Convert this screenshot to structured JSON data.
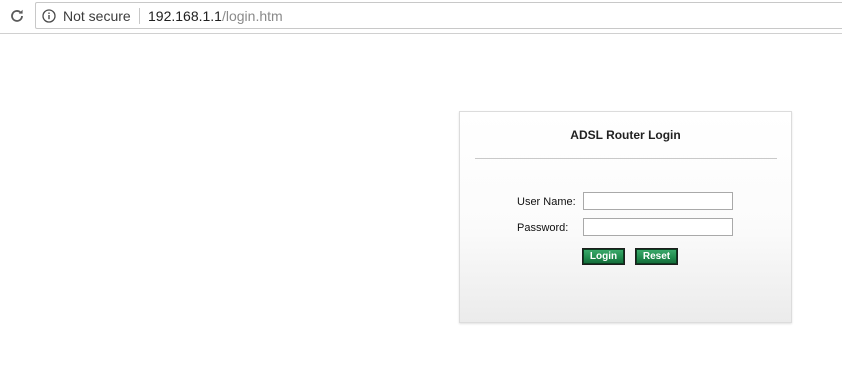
{
  "browser": {
    "security_label": "Not secure",
    "url_host": "192.168.1.1",
    "url_path": "/login.htm"
  },
  "login": {
    "title": "ADSL Router Login",
    "username_label": "User Name:",
    "username_value": "",
    "password_label": "Password:",
    "password_value": "",
    "login_button": "Login",
    "reset_button": "Reset"
  },
  "colors": {
    "button_green": "#1f8a4c",
    "panel_border": "#dcdcdc"
  },
  "icons": {
    "reload": "reload-icon",
    "info": "info-icon"
  }
}
